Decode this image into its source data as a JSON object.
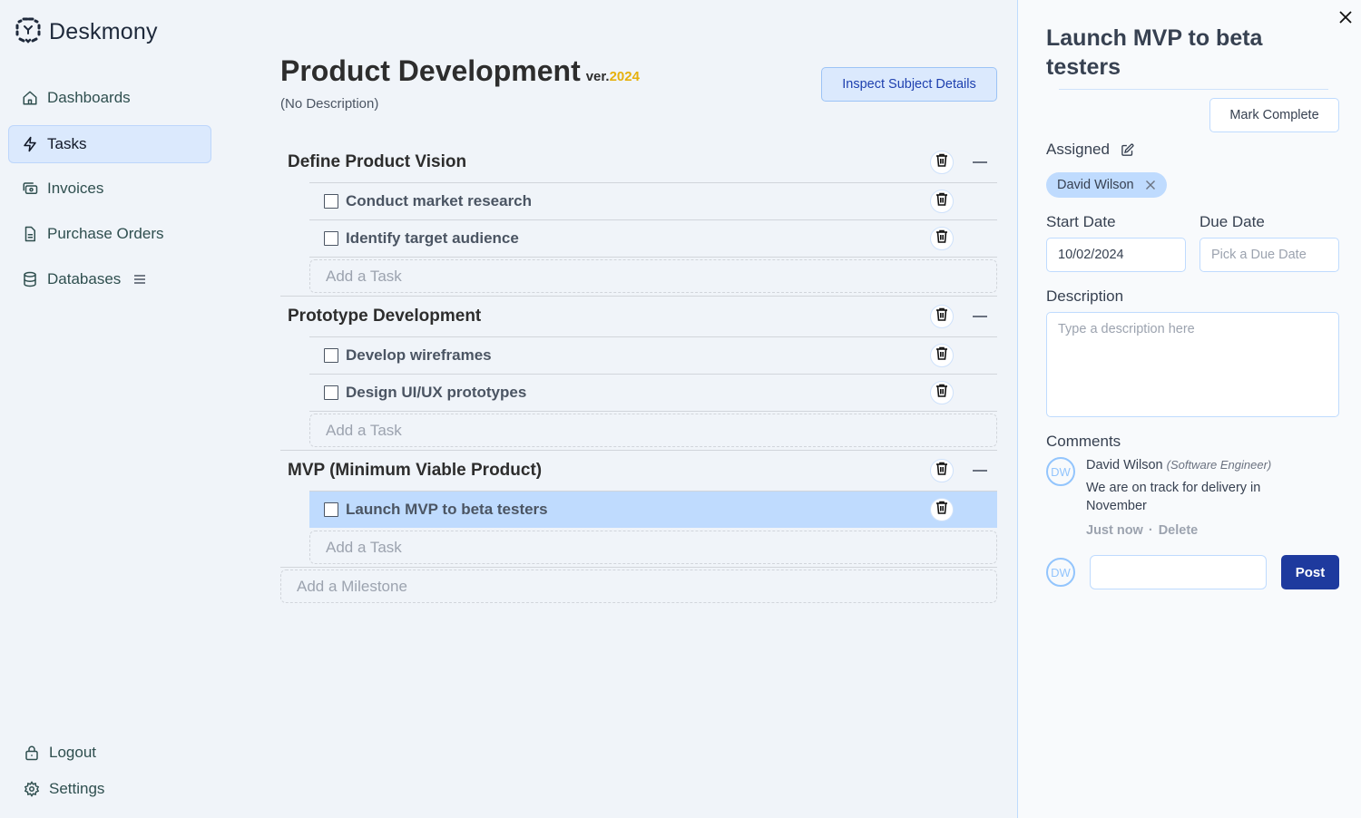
{
  "app": {
    "name": "Deskmony"
  },
  "sidebar": {
    "items": [
      {
        "label": "Dashboards",
        "icon": "home-icon"
      },
      {
        "label": "Tasks",
        "icon": "lightning-icon",
        "active": true
      },
      {
        "label": "Invoices",
        "icon": "invoice-icon"
      },
      {
        "label": "Purchase Orders",
        "icon": "document-icon"
      },
      {
        "label": "Databases",
        "icon": "database-icon"
      }
    ],
    "bottom": [
      {
        "label": "Logout",
        "icon": "lock-icon"
      },
      {
        "label": "Settings",
        "icon": "gear-icon"
      }
    ]
  },
  "main": {
    "title": "Product Development",
    "version_prefix": "ver.",
    "version_year": "2024",
    "description": "(No Description)",
    "inspect_button": "Inspect Subject Details",
    "add_task_placeholder": "Add a Task",
    "add_milestone_placeholder": "Add a Milestone",
    "milestones": [
      {
        "title": "Define Product Vision",
        "tasks": [
          {
            "label": "Conduct market research",
            "checked": false
          },
          {
            "label": "Identify target audience",
            "checked": false
          }
        ]
      },
      {
        "title": "Prototype Development",
        "tasks": [
          {
            "label": "Develop wireframes",
            "checked": false
          },
          {
            "label": "Design UI/UX prototypes",
            "checked": false
          }
        ]
      },
      {
        "title": "MVP (Minimum Viable Product)",
        "tasks": [
          {
            "label": "Launch MVP to beta testers",
            "checked": false,
            "selected": true
          }
        ]
      }
    ]
  },
  "panel": {
    "title": "Launch MVP to beta testers",
    "mark_complete": "Mark Complete",
    "assigned_label": "Assigned",
    "assignee": "David Wilson",
    "start_date_label": "Start Date",
    "start_date_value": "10/02/2024",
    "due_date_label": "Due Date",
    "due_date_placeholder": "Pick a Due Date",
    "description_label": "Description",
    "description_placeholder": "Type a description here",
    "comments_label": "Comments",
    "comments": [
      {
        "initials": "DW",
        "author": "David Wilson",
        "role": "(Software Engineer)",
        "text": "We are on track for delivery in November",
        "time": "Just now",
        "delete": "Delete",
        "separator": "·"
      }
    ],
    "current_user_initials": "DW",
    "post_button": "Post"
  }
}
